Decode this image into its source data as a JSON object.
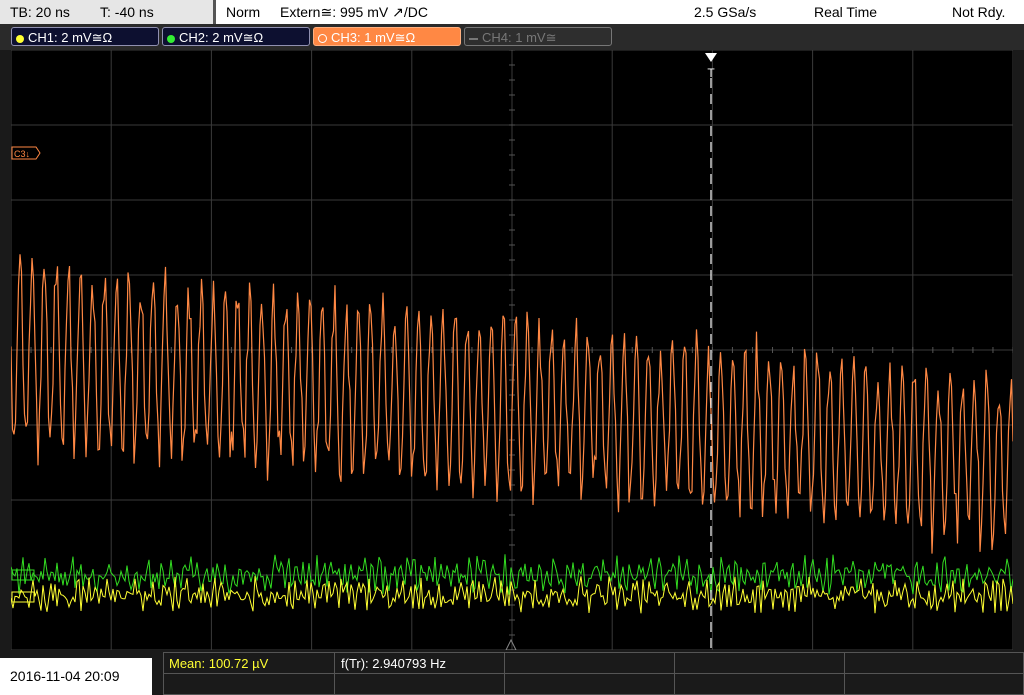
{
  "topbar": {
    "timebase": "TB: 20 ns",
    "trigger_time": "T: -40 ns",
    "mode": "Norm",
    "trigger_source": "Extern≅: 995 mV ↗/DC",
    "sample_rate": "2.5 GSa/s",
    "acq_mode": "Real Time",
    "status": "Not Rdy."
  },
  "channels": [
    {
      "label": "CH1: 2 mV≅Ω",
      "color": "#ffff33",
      "active": false
    },
    {
      "label": "CH2: 2 mV≅Ω",
      "color": "#33ee33",
      "active": false
    },
    {
      "label": "CH3: 1 mV≅Ω",
      "color": "#ff8844",
      "active": true
    },
    {
      "label": "CH4: 1 mV≅",
      "color": "#888888",
      "active": false
    }
  ],
  "screen": {
    "ch3_marker": "C3↓",
    "trigger_marker": "T",
    "colors": {
      "ch1": "#ffff33",
      "ch2": "#33dd22",
      "ch3": "#ff8844",
      "grid": "#3a3a3a"
    }
  },
  "footer": {
    "datetime": "2016-11-04 20:09",
    "mean_label": "Mean: 100.72 µV",
    "freq_label": "f(Tr): 2.940793 Hz"
  }
}
